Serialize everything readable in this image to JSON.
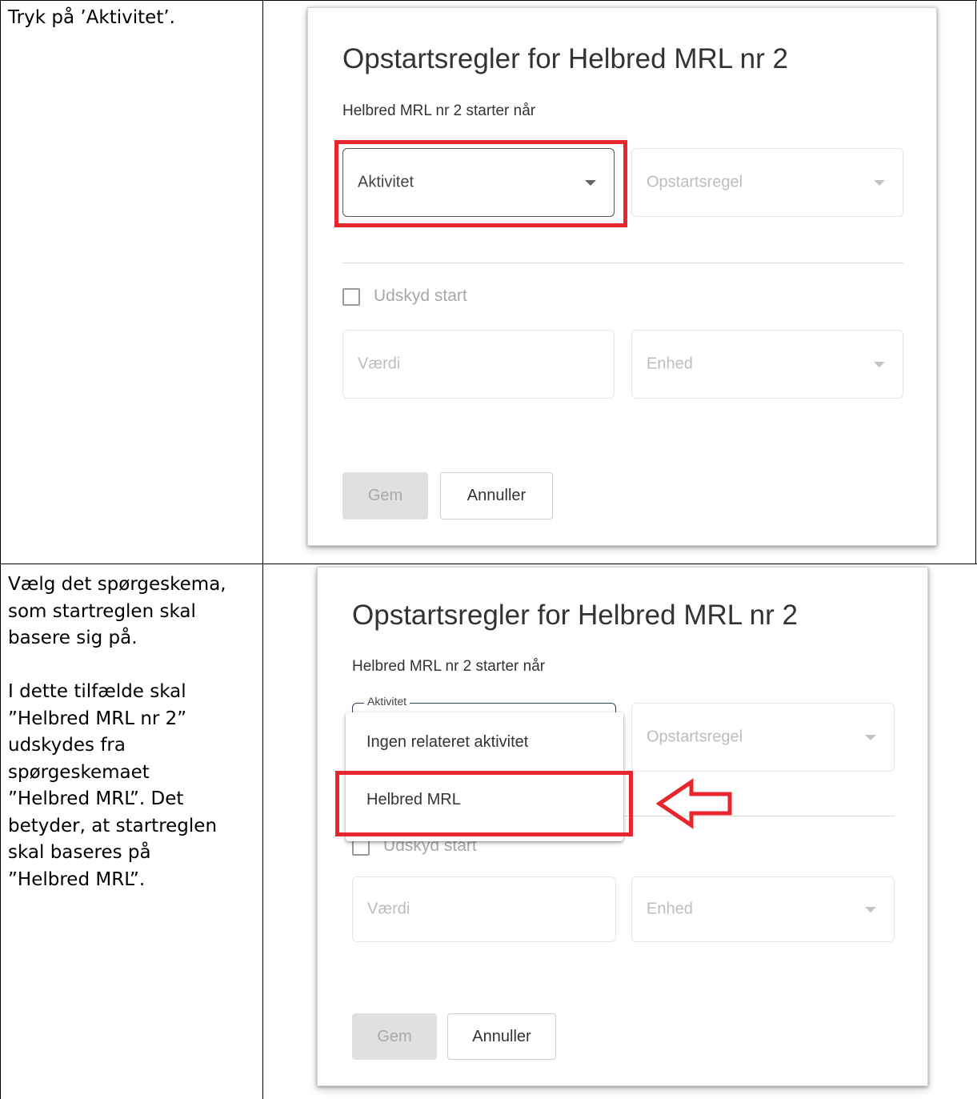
{
  "rows": [
    {
      "instruction": "Tryk på ’Aktivitet’.",
      "dialog": {
        "title": "Opstartsregler for Helbred MRL nr 2",
        "subtitle": "Helbred MRL nr 2 starter når",
        "activity_field": "Aktivitet",
        "rule_field": "Opstartsregel",
        "delay_checkbox": "Udskyd start",
        "value_field": "Værdi",
        "unit_field": "Enhed",
        "save_button": "Gem",
        "cancel_button": "Annuller"
      }
    },
    {
      "instruction_lines": [
        "Vælg det spørgeskema,",
        "som startreglen skal",
        "basere sig på.",
        "",
        "I dette tilfælde skal",
        "”Helbred MRL nr 2”",
        "udskydes fra",
        "spørgeskemaet",
        "”Helbred MRL”. Det",
        "betyder, at startreglen",
        "skal baseres på",
        "”Helbred MRL”."
      ],
      "dialog": {
        "title": "Opstartsregler for Helbred MRL nr 2",
        "subtitle": "Helbred MRL nr 2 starter når",
        "activity_label": "Aktivitet",
        "menu_items": [
          "Ingen relateret aktivitet",
          "Helbred MRL"
        ],
        "rule_field": "Opstartsregel",
        "delay_checkbox": "Udskyd start",
        "value_field": "Værdi",
        "unit_field": "Enhed",
        "save_button": "Gem",
        "cancel_button": "Annuller"
      }
    }
  ],
  "colors": {
    "highlight": "#e8242c",
    "table_border": "#000000"
  }
}
